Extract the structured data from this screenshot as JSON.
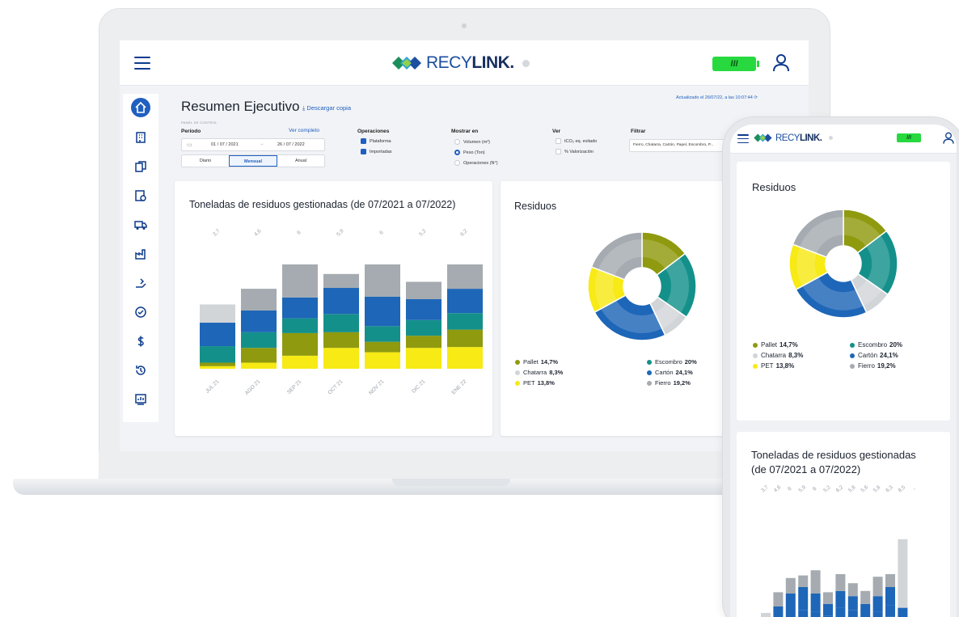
{
  "app": {
    "brand_prefix": "RECY",
    "brand_suffix": "LINK",
    "brand_mark": ".",
    "battery_label": "III"
  },
  "sidebar": {
    "items": [
      {
        "icon": "home-icon",
        "active": true
      },
      {
        "icon": "building-icon"
      },
      {
        "icon": "documents-icon"
      },
      {
        "icon": "certificate-icon"
      },
      {
        "icon": "truck-icon"
      },
      {
        "icon": "factory-icon"
      },
      {
        "icon": "recycle-hand-icon"
      },
      {
        "icon": "check-circle-icon"
      },
      {
        "icon": "dollar-icon"
      },
      {
        "icon": "history-icon"
      },
      {
        "icon": "report-icon"
      }
    ]
  },
  "header": {
    "title": "Resumen Ejecutivo",
    "download_label": "Descargar copia",
    "updated": "Actualizado el 26/07/22, a las 10:07:44",
    "panel_label": "PANEL DE CONTROL"
  },
  "filters": {
    "period_label": "Período",
    "see_full": "Ver completo",
    "date_from": "01 / 07 / 2021",
    "date_sep": "→",
    "date_to": "26 / 07 / 2022",
    "granularity": [
      "Diario",
      "Mensual",
      "Anual"
    ],
    "granularity_selected": "Mensual",
    "operations_label": "Operaciones",
    "operations": [
      {
        "label": "Plataforma",
        "checked": true
      },
      {
        "label": "Importadas",
        "checked": true
      }
    ],
    "show_in_label": "Mostrar en",
    "show_in": [
      {
        "label": "Volumen (m³)",
        "selected": false
      },
      {
        "label": "Peso (Ton)",
        "selected": true
      },
      {
        "label": "Operaciones (N°)",
        "selected": false
      }
    ],
    "view_label": "Ver",
    "view": [
      {
        "label": "tCO₂ eq. evitado",
        "checked": false
      },
      {
        "label": "% Valorización",
        "checked": false
      }
    ],
    "filter_label": "Filtrar",
    "filter_value": "Fierro, Chatarra, Cartón, Papel, Escombro, P..."
  },
  "colors": {
    "pallet": "#8f9a0e",
    "escombro": "#14908a",
    "chatarra": "#d2d5d8",
    "carton": "#1e66b8",
    "pet": "#f7ea15",
    "fierro": "#a5abb0",
    "brand_blue": "#1f5fbf",
    "brand_dark": "#0d3b8c"
  },
  "waste_legend": [
    {
      "name": "Pallet",
      "value": "14,7%",
      "color": "#8f9a0e"
    },
    {
      "name": "Escombro",
      "value": "20%",
      "color": "#14908a"
    },
    {
      "name": "Chatarra",
      "value": "8,3%",
      "color": "#d2d5d8"
    },
    {
      "name": "Cartón",
      "value": "24,1%",
      "color": "#1e66b8"
    },
    {
      "name": "PET",
      "value": "13,8%",
      "color": "#f7ea15"
    },
    {
      "name": "Fierro",
      "value": "19,2%",
      "color": "#a5abb0"
    }
  ],
  "chart_data": [
    {
      "type": "bar",
      "stacked": true,
      "title": "Toneladas de residuos gestionadas (de 07/2021 a 07/2022)",
      "categories": [
        "JUL 21",
        "AGO 21",
        "SEP 21",
        "OCT 21",
        "NOV 21",
        "DIC 21",
        "ENE 22"
      ],
      "totals": [
        "3,7",
        "4,6",
        "6",
        "5,9",
        "6",
        "5,2",
        "6,2"
      ],
      "series": [
        {
          "name": "PET",
          "color": "#f7ea15",
          "values": [
            0.15,
            0.35,
            0.75,
            1.2,
            0.95,
            1.2,
            1.25
          ]
        },
        {
          "name": "Pallet",
          "color": "#8f9a0e",
          "values": [
            0.2,
            0.85,
            1.3,
            0.9,
            0.6,
            0.7,
            1.0
          ]
        },
        {
          "name": "Escombro",
          "color": "#14908a",
          "values": [
            0.95,
            0.9,
            0.85,
            1.05,
            0.9,
            0.9,
            0.95
          ]
        },
        {
          "name": "Cartón",
          "color": "#1e66b8",
          "values": [
            1.35,
            1.25,
            1.2,
            1.5,
            1.7,
            1.2,
            1.4
          ]
        },
        {
          "name": "Fierro",
          "color": "#a5abb0",
          "values": [
            0.0,
            1.25,
            1.9,
            0.8,
            1.85,
            1.0,
            1.4
          ]
        },
        {
          "name": "Chatarra",
          "color": "#d2d5d8",
          "values": [
            1.05,
            0.0,
            0.0,
            0.0,
            0.0,
            0.0,
            0.0
          ]
        }
      ]
    },
    {
      "type": "pie",
      "title": "Residuos",
      "labels": [
        "Pallet",
        "Escombro",
        "Chatarra",
        "Cartón",
        "PET",
        "Fierro"
      ],
      "values": [
        14.7,
        20,
        8.3,
        24.1,
        13.8,
        19.2
      ],
      "colors": [
        "#8f9a0e",
        "#14908a",
        "#d2d5d8",
        "#1e66b8",
        "#f7ea15",
        "#a5abb0"
      ]
    }
  ],
  "mobile": {
    "pie_title": "Residuos",
    "bar_title_line1": "Toneladas de residuos gestionadas",
    "bar_title_line2": "(de 07/2021 a 07/2022)",
    "bar_totals": [
      "3,7",
      "4,6",
      "6",
      "5,9",
      "6",
      "5,2",
      "6,2",
      "5,8",
      "5,6",
      "5,8",
      "6,3",
      "8,5",
      "-"
    ],
    "bar_stacks": [
      [
        0,
        0,
        0,
        0,
        0,
        1.0
      ],
      [
        0.3,
        0.0,
        0.3,
        0.9,
        1.1,
        0
      ],
      [
        0.3,
        0.2,
        0.5,
        1.5,
        1.2,
        0
      ],
      [
        0.3,
        0.2,
        0.7,
        1.8,
        0.9,
        0
      ],
      [
        0.2,
        0.2,
        0.7,
        1.4,
        1.8,
        0
      ],
      [
        0.2,
        0.2,
        0.4,
        0.9,
        0.9,
        0
      ],
      [
        0.3,
        0.3,
        0.8,
        1.3,
        1.3,
        0
      ],
      [
        0.3,
        0.2,
        0.7,
        1.1,
        1.0,
        0
      ],
      [
        0.2,
        0.2,
        0.6,
        0.7,
        1.0,
        0
      ],
      [
        0.2,
        0.3,
        0.6,
        1.2,
        1.5,
        0
      ],
      [
        0.3,
        0.4,
        0.9,
        1.4,
        1.0,
        0
      ],
      [
        0.0,
        0.0,
        0.0,
        1.4,
        0.0,
        5.3
      ]
    ]
  }
}
